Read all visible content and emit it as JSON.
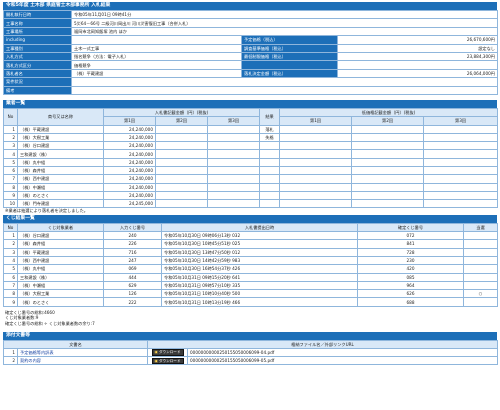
{
  "title": "令和5年度 土木部 県庭管土木部事務所 入札結果",
  "info_rows": [
    {
      "label": "開札執行日時",
      "value": "令和05年11月01日 09時41分"
    },
    {
      "label": "工事名称",
      "value": "5災64－66号 二級河川岡出川 河川災害復旧工事（合併入札）"
    },
    {
      "label": "工事場所",
      "value": "福岡市北岡知飯塚 池内 ほか"
    }
  ],
  "pair_rows": [
    {
      "l1": "including",
      "v1": "",
      "l2": "予定価格（税込）",
      "v2": "26,670,600円"
    },
    {
      "l1": "工事種別",
      "v1": "土木一式工事",
      "l2": "調査基準価格（税込）",
      "v2": "設定なし"
    },
    {
      "l1": "入札方式",
      "v1": "指名競争（方法：電子入札）",
      "l2": "最低制限価格（税込）",
      "v2": "23,884,300円"
    },
    {
      "l1": "落札方式区分",
      "v1": "価格競争",
      "l2": "",
      "v2": ""
    },
    {
      "l1": "落札者名",
      "v1": "（株）平蔵建設",
      "l2": "落札決定金額（税込）",
      "v2": "26,064,000円"
    }
  ],
  "single_rows": [
    {
      "label": "案件状況",
      "value": ""
    },
    {
      "label": "備考",
      "value": ""
    }
  ],
  "bidders_section": {
    "header": "業者一覧",
    "col_no": "No",
    "col_name": "商号又は名称",
    "col_bid": "入札書記載金額（円）(税抜)",
    "col_result": "結果",
    "col_low": "低価格記載金額（円）(税抜)",
    "round1": "第1回",
    "round2": "第2回",
    "round3": "第3回",
    "rows": [
      {
        "no": "1",
        "name": "（株）平蔵建設",
        "bid": "24,240,000",
        "result": "落札"
      },
      {
        "no": "2",
        "name": "（株）大樹工業",
        "bid": "24,240,000",
        "result": "失格"
      },
      {
        "no": "3",
        "name": "（株）谷口建設",
        "bid": "24,240,000",
        "result": ""
      },
      {
        "no": "4",
        "name": "三和建設（株）",
        "bid": "24,240,000",
        "result": ""
      },
      {
        "no": "5",
        "name": "（株）丸中組",
        "bid": "24,240,000",
        "result": ""
      },
      {
        "no": "6",
        "name": "（株）森井組",
        "bid": "24,240,000",
        "result": ""
      },
      {
        "no": "7",
        "name": "（株）西中建設",
        "bid": "24,240,000",
        "result": ""
      },
      {
        "no": "8",
        "name": "（株）中瀬組",
        "bid": "24,240,000",
        "result": ""
      },
      {
        "no": "9",
        "name": "（株）のとさく",
        "bid": "24,240,000",
        "result": ""
      },
      {
        "no": "10",
        "name": "（株）門寺建設",
        "bid": "24,245,000",
        "result": ""
      }
    ]
  },
  "lottery_note": "※業者は抽選により落札者を決定しました。",
  "lottery_section": {
    "header": "くじ結果一覧",
    "col_no": "No",
    "col_name": "くじ対象業者",
    "col_num": "入力くじ番号",
    "col_date": "入札書提出日時",
    "col_conf": "確定くじ番号",
    "col_win": "当選",
    "rows": [
      {
        "no": "1",
        "name": "（株）谷口建設",
        "num": "240",
        "date": "令和05年10月30日 09時06分13秒 032",
        "conf": "072",
        "win": ""
      },
      {
        "no": "2",
        "name": "（株）森井組",
        "num": "226",
        "date": "令和05年10月30日 10時45分51秒 025",
        "conf": "841",
        "win": ""
      },
      {
        "no": "3",
        "name": "（株）平蔵建設",
        "num": "716",
        "date": "令和05年10月30日 13時47分50秒 012",
        "conf": "728",
        "win": ""
      },
      {
        "no": "4",
        "name": "（株）西中建設",
        "num": "247",
        "date": "令和05年10月30日 14時42分59秒 983",
        "conf": "230",
        "win": ""
      },
      {
        "no": "5",
        "name": "（株）丸中組",
        "num": "069",
        "date": "令和05年10月30日 16時54分37秒 426",
        "conf": "420",
        "win": ""
      },
      {
        "no": "6",
        "name": "三和建設（株）",
        "num": "444",
        "date": "令和05年10月31日 09時15分20秒 641",
        "conf": "085",
        "win": ""
      },
      {
        "no": "7",
        "name": "（株）中瀬組",
        "num": "629",
        "date": "令和05年10月31日 09時57分10秒 335",
        "conf": "964",
        "win": ""
      },
      {
        "no": "8",
        "name": "（株）大樹工業",
        "num": "126",
        "date": "令和05年10月31日 10時10分40秒 500",
        "conf": "626",
        "win": "○"
      },
      {
        "no": "9",
        "name": "（株）のとさく",
        "num": "222",
        "date": "令和05年10月31日 10時13分19秒 466",
        "conf": "688",
        "win": ""
      }
    ]
  },
  "calc_notes": [
    "確定くじ番号の総和:4660",
    "くじ対象業者数:9",
    "確定くじ番号の総和 ÷ くじ対象業者数の余り:7"
  ],
  "attach_section": {
    "header": "添付文書等",
    "col_doc": "文書名",
    "col_file": "格納ファイル名／外部リンクURL",
    "download_label": "ダウンロード",
    "rows": [
      {
        "no": "1",
        "name": "予定価格等内訳表",
        "file": "00000000000250155050006099-04.pdf"
      },
      {
        "no": "2",
        "name": "契約の内容",
        "file": "00000000000250155050006099-05.pdf"
      }
    ]
  }
}
